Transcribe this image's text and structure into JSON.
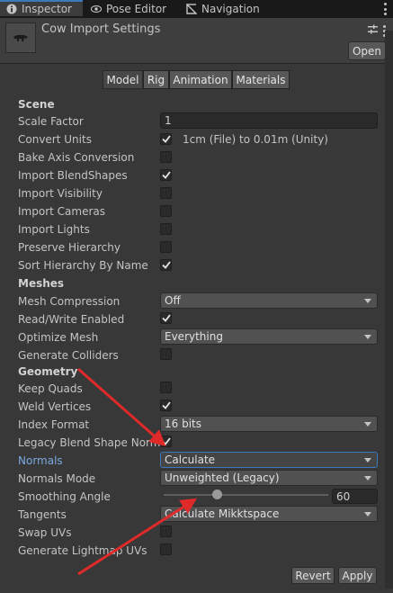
{
  "tabs": [
    {
      "label": "Inspector",
      "icon": "info-icon",
      "active": true
    },
    {
      "label": "Pose Editor",
      "icon": "eye-icon",
      "active": false
    },
    {
      "label": "Navigation",
      "icon": "navigation-icon",
      "active": false
    }
  ],
  "header": {
    "title": "Cow Import Settings",
    "open_label": "Open"
  },
  "segments": [
    "Model",
    "Rig",
    "Animation",
    "Materials"
  ],
  "sections": {
    "scene": "Scene",
    "meshes": "Meshes",
    "geometry": "Geometry"
  },
  "rows": {
    "scale_factor": {
      "label": "Scale Factor",
      "value": "1"
    },
    "convert_units": {
      "label": "Convert Units",
      "checked": true,
      "note": "1cm (File) to 0.01m (Unity)"
    },
    "bake_axis": {
      "label": "Bake Axis Conversion",
      "checked": false
    },
    "import_blendshapes": {
      "label": "Import BlendShapes",
      "checked": true
    },
    "import_visibility": {
      "label": "Import Visibility",
      "checked": false
    },
    "import_cameras": {
      "label": "Import Cameras",
      "checked": false
    },
    "import_lights": {
      "label": "Import Lights",
      "checked": false
    },
    "preserve_hierarchy": {
      "label": "Preserve Hierarchy",
      "checked": false
    },
    "sort_hierarchy": {
      "label": "Sort Hierarchy By Name",
      "checked": true
    },
    "mesh_compression": {
      "label": "Mesh Compression",
      "value": "Off"
    },
    "read_write": {
      "label": "Read/Write Enabled",
      "checked": true
    },
    "optimize_mesh": {
      "label": "Optimize Mesh",
      "value": "Everything"
    },
    "generate_colliders": {
      "label": "Generate Colliders",
      "checked": false
    },
    "keep_quads": {
      "label": "Keep Quads",
      "checked": false
    },
    "weld_vertices": {
      "label": "Weld Vertices",
      "checked": true
    },
    "index_format": {
      "label": "Index Format",
      "value": "16 bits"
    },
    "legacy_blend": {
      "label": "Legacy Blend Shape Norma",
      "checked": true
    },
    "normals": {
      "label": "Normals",
      "value": "Calculate"
    },
    "normals_mode": {
      "label": "Normals Mode",
      "value": "Unweighted (Legacy)"
    },
    "smoothing_angle": {
      "label": "Smoothing Angle",
      "value": "60",
      "fraction": 0.33
    },
    "tangents": {
      "label": "Tangents",
      "value": "Calculate Mikktspace"
    },
    "swap_uvs": {
      "label": "Swap UVs",
      "checked": false
    },
    "lightmap_uvs": {
      "label": "Generate Lightmap UVs",
      "checked": false
    }
  },
  "footer": {
    "revert_label": "Revert",
    "apply_label": "Apply"
  },
  "colors": {
    "background": "#383838",
    "accent": "#3a79bb",
    "annotation_arrow": "#e02a2a"
  }
}
